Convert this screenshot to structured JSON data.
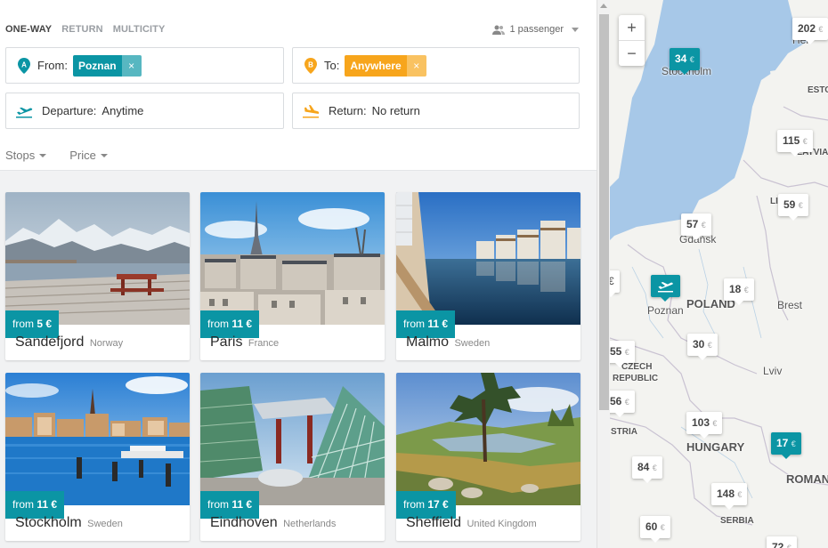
{
  "trip_types": [
    "ONE-WAY",
    "RETURN",
    "MULTICITY"
  ],
  "trip_type_active": "ONE-WAY",
  "passengers": "1 passenger",
  "from": {
    "label": "From:",
    "pin": "A",
    "chip": "Poznan",
    "chip_close": "×"
  },
  "to": {
    "label": "To:",
    "pin": "B",
    "chip": "Anywhere",
    "chip_close": "×"
  },
  "departure": {
    "label": "Departure:",
    "value": "Anytime"
  },
  "return": {
    "label": "Return:",
    "value": "No return"
  },
  "filters": [
    "Stops",
    "Price"
  ],
  "colors": {
    "teal": "#0b95a4",
    "orange": "#f7a51c"
  },
  "destinations": [
    {
      "city": "Sandefjord",
      "country": "Norway",
      "price_prefix": "from",
      "price": "5 €"
    },
    {
      "city": "Paris",
      "country": "France",
      "price_prefix": "from",
      "price": "11 €"
    },
    {
      "city": "Malmo",
      "country": "Sweden",
      "price_prefix": "from",
      "price": "11 €"
    },
    {
      "city": "Stockholm",
      "country": "Sweden",
      "price_prefix": "from",
      "price": "11 €"
    },
    {
      "city": "Eindhoven",
      "country": "Netherlands",
      "price_prefix": "from",
      "price": "11 €"
    },
    {
      "city": "Sheffield",
      "country": "United Kingdom",
      "price_prefix": "from",
      "price": "17 €"
    }
  ],
  "map": {
    "zoom_in": "+",
    "zoom_out": "−",
    "prices": [
      {
        "value": "202",
        "cur": "€",
        "highlight": false
      },
      {
        "value": "34",
        "cur": "€",
        "highlight": true
      },
      {
        "value": "115",
        "cur": "€",
        "highlight": false
      },
      {
        "value": "59",
        "cur": "€",
        "highlight": false
      },
      {
        "value": "57",
        "cur": "€",
        "highlight": false
      },
      {
        "value": "18",
        "cur": "€",
        "highlight": false
      },
      {
        "value": "€",
        "cur": "",
        "highlight": false
      },
      {
        "value": "30",
        "cur": "€",
        "highlight": false
      },
      {
        "value": "55",
        "cur": "€",
        "highlight": false
      },
      {
        "value": "56",
        "cur": "€",
        "highlight": false
      },
      {
        "value": "103",
        "cur": "€",
        "highlight": false
      },
      {
        "value": "17",
        "cur": "€",
        "highlight": true
      },
      {
        "value": "84",
        "cur": "€",
        "highlight": false
      },
      {
        "value": "148",
        "cur": "€",
        "highlight": false
      },
      {
        "value": "60",
        "cur": "€",
        "highlight": false
      },
      {
        "value": "72",
        "cur": "€",
        "highlight": false
      }
    ],
    "labels": {
      "helsinki": "Hel",
      "stockholm": "Stockholm",
      "estonia": "ESTO",
      "latvia": "LATVIA",
      "lithuania": "LI",
      "gdansk": "Gdańsk",
      "poznan": "Poznan",
      "poland": "POLAND",
      "brest": "Brest",
      "czech": "CZECH",
      "republic": "REPUBLIC",
      "lviv": "Lviv",
      "austria": "STRIA",
      "hungary": "HUNGARY",
      "romania": "ROMAN",
      "serbia": "SERBIA"
    }
  }
}
